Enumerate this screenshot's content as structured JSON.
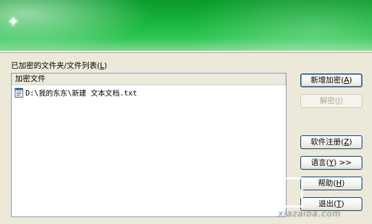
{
  "list_label": {
    "text": "已加密的文件夹/文件列表",
    "mnemonic": "L"
  },
  "list": {
    "column_header": "加密文件",
    "rows": [
      {
        "path": "D:\\我的东东\\新建 文本文档.txt",
        "icon": "text-file-icon"
      }
    ]
  },
  "buttons": {
    "add_encrypt": {
      "label": "新增加密",
      "mnemonic": "A",
      "enabled": true
    },
    "decrypt": {
      "label": "解密",
      "mnemonic": "J",
      "enabled": false
    },
    "register": {
      "label": "软件注册",
      "mnemonic": "Z",
      "enabled": true
    },
    "language": {
      "label": "语言",
      "mnemonic": "Y",
      "suffix": ">>",
      "enabled": true
    },
    "help": {
      "label": "帮助",
      "mnemonic": "H",
      "enabled": true
    },
    "exit": {
      "label": "退出",
      "mnemonic": "T",
      "enabled": true
    }
  },
  "watermark": {
    "text": "xiazaiba.com"
  },
  "colors": {
    "banner_green": "#19b53e",
    "dialog_bg": "#ece9d8",
    "button_border": "#003c74",
    "disabled_text": "#aca899"
  }
}
